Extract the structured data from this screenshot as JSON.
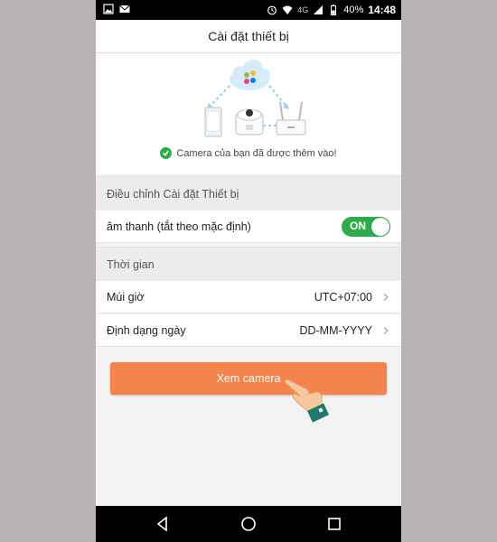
{
  "status_bar": {
    "network": "4G",
    "battery": "40%",
    "time": "14:48"
  },
  "header": {
    "title": "Cài đặt thiết bị"
  },
  "hero": {
    "success_message": "Camera của bạn đã được thêm vào!"
  },
  "sections": {
    "device_settings_title": "Điều chỉnh Cài đặt Thiết bị",
    "time_title": "Thời gian"
  },
  "sound": {
    "label": "âm thanh (tắt theo mặc định)",
    "toggle_label": "ON",
    "enabled": true
  },
  "timezone": {
    "label": "Múi giờ",
    "value": "UTC+07:00"
  },
  "date_format": {
    "label": "Định dạng ngày",
    "value": "DD-MM-YYYY"
  },
  "action": {
    "view_camera": "Xem camera"
  },
  "colors": {
    "accent": "#f5844c",
    "toggle_on": "#2eab4a",
    "success": "#2eab4a",
    "cloud": "#cfe6f7"
  },
  "icons": {
    "status_left": [
      "image-icon",
      "mail-icon"
    ],
    "status_right": [
      "alarm-icon",
      "wifi-icon",
      "signal-icon",
      "battery-icon"
    ],
    "nav": [
      "back-icon",
      "home-icon",
      "recents-icon"
    ]
  }
}
